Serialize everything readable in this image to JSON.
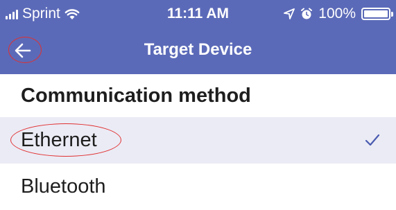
{
  "status_bar": {
    "carrier": "Sprint",
    "time": "11:11 AM",
    "battery_percent": "100%",
    "battery_level": 1.0,
    "icons": [
      "signal-bars-icon",
      "wifi-icon",
      "location-arrow-icon",
      "alarm-clock-icon",
      "battery-icon"
    ]
  },
  "nav": {
    "title": "Target Device",
    "back_icon": "back-arrow-icon"
  },
  "section": {
    "title": "Communication method"
  },
  "options": [
    {
      "label": "Ethernet",
      "selected": true
    },
    {
      "label": "Bluetooth",
      "selected": false
    }
  ],
  "colors": {
    "header_bg": "#5b6ab8",
    "selected_row_bg": "#ebebf5",
    "accent": "#4a5bb0",
    "annotation": "#e03030"
  }
}
